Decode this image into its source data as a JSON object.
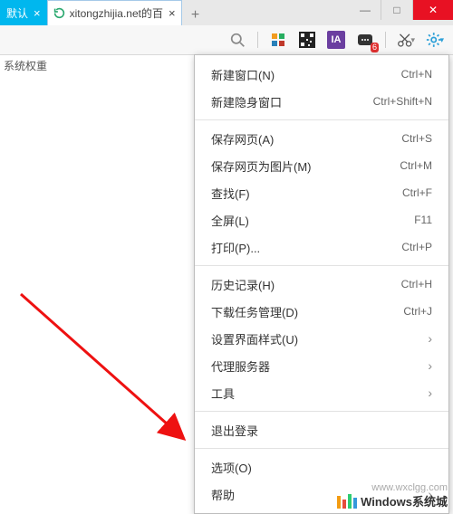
{
  "tabs": {
    "active_label": "默认",
    "inactive_label": "xitongzhijia.net的百"
  },
  "window_controls": {
    "min": "—",
    "max": "□",
    "close": "✕"
  },
  "toolbar": {
    "search": "search",
    "apps": "apps",
    "qr": "qr",
    "ia": "IA",
    "notify_badge": "6",
    "scissors": "scissors",
    "gear": "gear"
  },
  "sidebar": {
    "col_label": "系统权重"
  },
  "menu": {
    "groups": [
      [
        {
          "label": "新建窗口(N)",
          "shortcut": "Ctrl+N"
        },
        {
          "label": "新建隐身窗口",
          "shortcut": "Ctrl+Shift+N"
        }
      ],
      [
        {
          "label": "保存网页(A)",
          "shortcut": "Ctrl+S"
        },
        {
          "label": "保存网页为图片(M)",
          "shortcut": "Ctrl+M"
        },
        {
          "label": "查找(F)",
          "shortcut": "Ctrl+F"
        },
        {
          "label": "全屏(L)",
          "shortcut": "F11"
        },
        {
          "label": "打印(P)...",
          "shortcut": "Ctrl+P"
        }
      ],
      [
        {
          "label": "历史记录(H)",
          "shortcut": "Ctrl+H"
        },
        {
          "label": "下载任务管理(D)",
          "shortcut": "Ctrl+J"
        },
        {
          "label": "设置界面样式(U)",
          "submenu": true
        },
        {
          "label": "代理服务器",
          "submenu": true
        },
        {
          "label": "工具",
          "submenu": true
        }
      ],
      [
        {
          "label": "退出登录"
        }
      ],
      [
        {
          "label": "选项(O)"
        },
        {
          "label": "帮助",
          "submenu": true
        }
      ]
    ]
  },
  "watermark": {
    "text": "Windows系统城",
    "url": "www.wxclgg.com"
  }
}
